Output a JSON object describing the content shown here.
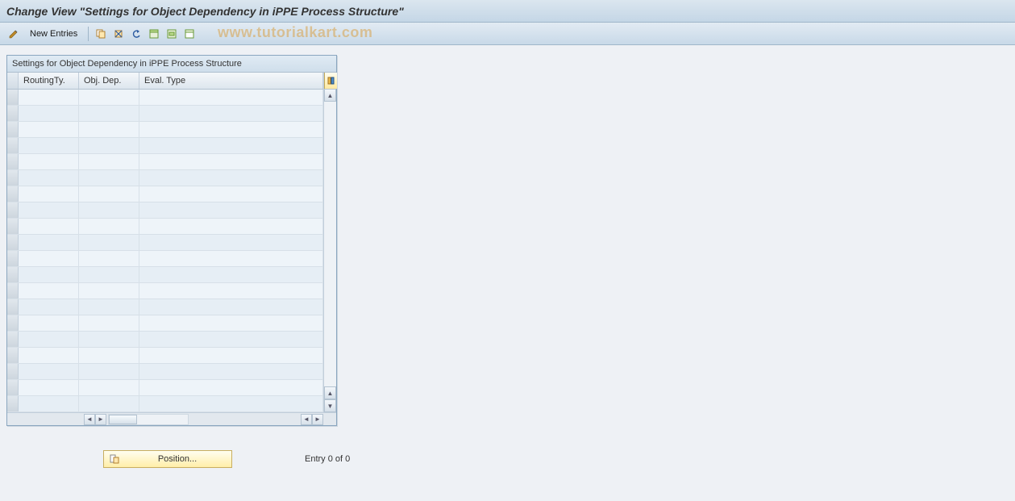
{
  "title": "Change View \"Settings for Object Dependency in iPPE Process Structure\"",
  "toolbar": {
    "new_entries_label": "New Entries"
  },
  "watermark": "www.tutorialkart.com",
  "grid": {
    "title": "Settings for Object Dependency in iPPE Process Structure",
    "columns": {
      "routing": "RoutingTy.",
      "objdep": "Obj. Dep.",
      "eval": "Eval. Type"
    },
    "rows": []
  },
  "footer": {
    "position_label": "Position...",
    "entry_text": "Entry 0 of 0"
  },
  "icons": {
    "toggle": "toggle-display-change-icon",
    "copy": "copy-icon",
    "delete": "delete-icon",
    "undo": "undo-icon",
    "select_all": "select-all-icon",
    "select_block": "select-block-icon",
    "deselect_all": "deselect-all-icon",
    "config": "table-settings-icon",
    "position_icon": "position-icon"
  }
}
